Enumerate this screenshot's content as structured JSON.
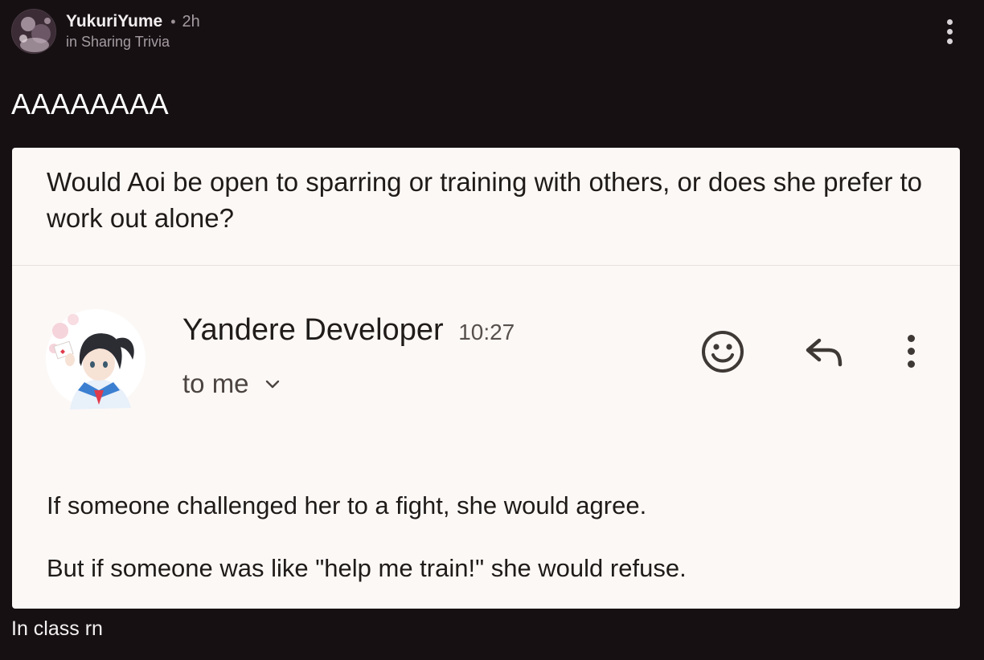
{
  "post": {
    "author": "YukuriYume",
    "separator": "•",
    "time": "2h",
    "community": "in Sharing Trivia",
    "title": "AAAAAAAA",
    "caption": "In class rn"
  },
  "screenshot": {
    "question": "Would Aoi be open to sparring or training with others, or does she prefer to work out alone?",
    "sender_name": "Yandere Developer",
    "sender_time": "10:27",
    "recipient": "to me",
    "body": [
      "If someone challenged her to a fight, she would agree.",
      "But if someone was like \"help me train!\" she would refuse."
    ]
  },
  "icons": {
    "post_menu": "more-vertical-icon",
    "recipient_toggle": "chevron-down-icon",
    "react": "smiley-emoji-icon",
    "reply": "reply-arrow-icon",
    "message_menu": "more-vertical-icon"
  },
  "colors": {
    "page_background": "#161013",
    "card_background": "#fcf8f6",
    "muted_text": "#a49ba0"
  }
}
